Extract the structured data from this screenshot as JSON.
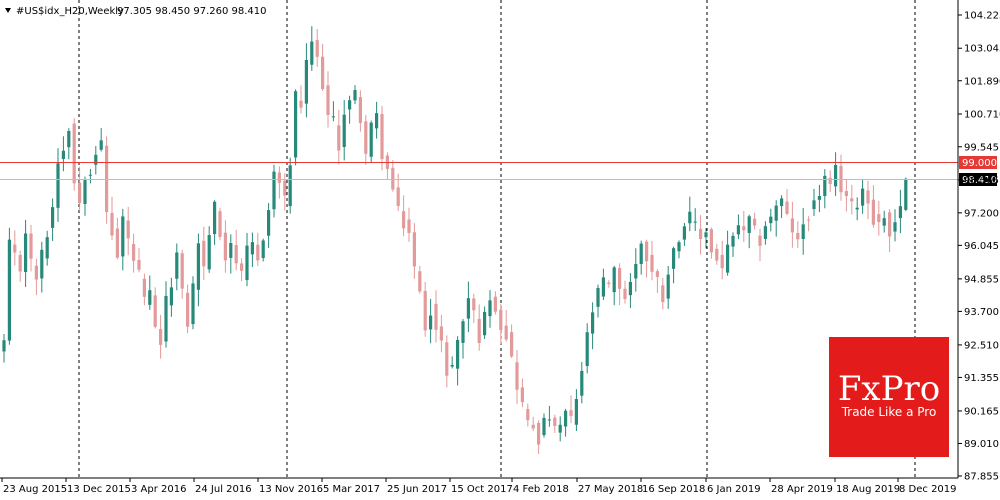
{
  "chart_data": {
    "type": "candlestick",
    "symbol": "#US$idx_H20,Weekly",
    "header_values": "97.305 98.450 97.260 98.410",
    "ylim": [
      87.8,
      104.3
    ],
    "y_ticks": [
      "104.225",
      "103.045",
      "101.890",
      "100.710",
      "99.545",
      "98.365",
      "97.200",
      "96.045",
      "94.855",
      "93.700",
      "92.510",
      "91.355",
      "90.165",
      "89.010",
      "87.855"
    ],
    "x_ticks": [
      "23 Aug 2015",
      "13 Dec 2015",
      "3 Apr 2016",
      "24 Jul 2016",
      "13 Nov 2016",
      "5 Mar 2017",
      "25 Jun 2017",
      "15 Oct 2017",
      "4 Feb 2018",
      "27 May 2018",
      "16 Sep 2018",
      "6 Jan 2019",
      "28 Apr 2019",
      "18 Aug 2019",
      "8 Dec 2019"
    ],
    "vertical_gridlines_at": [
      "13 Dec 2015",
      "13 Nov 2016",
      "4 Feb 2018",
      "6 Jan 2019",
      "8 Dec 2019"
    ],
    "horizontal_lines": [
      {
        "label": "99.000",
        "value": 99.0,
        "color": "#e53935"
      },
      {
        "label": "98.410",
        "value": 98.41,
        "color": "#bdbdbd"
      }
    ],
    "close_path": [
      [
        0,
        92.6
      ],
      [
        1,
        96.0
      ],
      [
        3,
        95.2
      ],
      [
        4,
        96.6
      ],
      [
        5,
        95.4
      ],
      [
        6,
        94.9
      ],
      [
        8,
        96.5
      ],
      [
        9,
        97.4
      ],
      [
        10,
        99.1
      ],
      [
        11,
        99.5
      ],
      [
        12,
        100.3
      ],
      [
        13,
        98.3
      ],
      [
        14,
        97.6
      ],
      [
        15,
        98.6
      ],
      [
        16,
        98.8
      ],
      [
        17,
        99.4
      ],
      [
        18,
        99.6
      ],
      [
        19,
        97.2
      ],
      [
        20,
        96.5
      ],
      [
        21,
        95.6
      ],
      [
        22,
        97.0
      ],
      [
        23,
        96.2
      ],
      [
        24,
        95.5
      ],
      [
        25,
        95.0
      ],
      [
        26,
        94.0
      ],
      [
        27,
        94.3
      ],
      [
        28,
        93.0
      ],
      [
        29,
        92.6
      ],
      [
        30,
        94.0
      ],
      [
        31,
        94.8
      ],
      [
        32,
        95.7
      ],
      [
        33,
        94.3
      ],
      [
        34,
        93.3
      ],
      [
        35,
        94.6
      ],
      [
        36,
        96.2
      ],
      [
        37,
        95.2
      ],
      [
        38,
        96.5
      ],
      [
        39,
        97.4
      ],
      [
        40,
        96.4
      ],
      [
        41,
        95.7
      ],
      [
        42,
        96.2
      ],
      [
        43,
        95.5
      ],
      [
        44,
        94.9
      ],
      [
        45,
        95.8
      ],
      [
        46,
        96.0
      ],
      [
        47,
        95.5
      ],
      [
        48,
        96.4
      ],
      [
        49,
        97.3
      ],
      [
        50,
        98.6
      ],
      [
        51,
        98.3
      ],
      [
        52,
        97.6
      ],
      [
        53,
        99.0
      ],
      [
        54,
        101.3
      ],
      [
        55,
        101.0
      ],
      [
        56,
        102.4
      ],
      [
        57,
        103.3
      ],
      [
        58,
        102.6
      ],
      [
        59,
        101.8
      ],
      [
        60,
        100.6
      ],
      [
        61,
        100.4
      ],
      [
        62,
        99.6
      ],
      [
        63,
        100.8
      ],
      [
        64,
        101.1
      ],
      [
        65,
        101.4
      ],
      [
        66,
        100.6
      ],
      [
        67,
        99.3
      ],
      [
        68,
        100.2
      ],
      [
        69,
        100.6
      ],
      [
        70,
        99.3
      ],
      [
        71,
        98.7
      ],
      [
        72,
        98.0
      ],
      [
        73,
        97.2
      ],
      [
        74,
        96.8
      ],
      [
        75,
        96.5
      ],
      [
        76,
        95.2
      ],
      [
        77,
        94.3
      ],
      [
        78,
        93.2
      ],
      [
        79,
        93.8
      ],
      [
        80,
        93.0
      ],
      [
        81,
        92.5
      ],
      [
        82,
        91.6
      ],
      [
        83,
        91.8
      ],
      [
        84,
        92.6
      ],
      [
        85,
        93.4
      ],
      [
        86,
        94.2
      ],
      [
        87,
        93.6
      ],
      [
        88,
        92.8
      ],
      [
        89,
        93.5
      ],
      [
        90,
        94.3
      ],
      [
        91,
        93.9
      ],
      [
        92,
        93.2
      ],
      [
        93,
        92.9
      ],
      [
        94,
        92.0
      ],
      [
        95,
        91.1
      ],
      [
        96,
        90.4
      ],
      [
        97,
        89.7
      ],
      [
        98,
        89.6
      ],
      [
        99,
        89.2
      ],
      [
        100,
        89.7
      ],
      [
        101,
        90.0
      ],
      [
        102,
        89.4
      ],
      [
        103,
        89.6
      ],
      [
        104,
        90.1
      ],
      [
        105,
        89.8
      ],
      [
        106,
        90.6
      ],
      [
        107,
        91.6
      ],
      [
        108,
        92.8
      ],
      [
        109,
        93.7
      ],
      [
        110,
        94.3
      ],
      [
        111,
        94.8
      ],
      [
        112,
        94.5
      ],
      [
        113,
        95.1
      ],
      [
        114,
        94.6
      ],
      [
        115,
        94.2
      ],
      [
        116,
        94.8
      ],
      [
        117,
        95.3
      ],
      [
        118,
        96.2
      ],
      [
        119,
        95.6
      ],
      [
        120,
        95.1
      ],
      [
        121,
        94.8
      ],
      [
        122,
        94.2
      ],
      [
        123,
        95.2
      ],
      [
        124,
        95.8
      ],
      [
        125,
        96.4
      ],
      [
        126,
        96.8
      ],
      [
        127,
        97.0
      ],
      [
        128,
        96.7
      ],
      [
        129,
        96.3
      ],
      [
        130,
        96.6
      ],
      [
        131,
        95.8
      ],
      [
        132,
        95.6
      ],
      [
        133,
        95.2
      ],
      [
        134,
        95.9
      ],
      [
        135,
        96.3
      ],
      [
        136,
        96.8
      ],
      [
        137,
        96.4
      ],
      [
        138,
        96.9
      ],
      [
        139,
        96.5
      ],
      [
        140,
        96.2
      ],
      [
        141,
        96.8
      ],
      [
        142,
        97.0
      ],
      [
        143,
        97.5
      ],
      [
        144,
        97.6
      ],
      [
        145,
        97.0
      ],
      [
        146,
        96.6
      ],
      [
        147,
        96.1
      ],
      [
        148,
        96.8
      ],
      [
        149,
        97.2
      ],
      [
        150,
        97.5
      ],
      [
        151,
        97.9
      ],
      [
        152,
        98.4
      ],
      [
        153,
        98.0
      ],
      [
        154,
        98.7
      ],
      [
        155,
        98.1
      ],
      [
        156,
        97.8
      ],
      [
        157,
        97.4
      ],
      [
        158,
        97.6
      ],
      [
        159,
        98.1
      ],
      [
        160,
        97.6
      ],
      [
        161,
        97.0
      ],
      [
        162,
        96.8
      ],
      [
        163,
        97.1
      ],
      [
        164,
        96.4
      ],
      [
        165,
        97.0
      ],
      [
        166,
        97.3
      ],
      [
        167,
        98.41
      ]
    ]
  },
  "branding": {
    "logo_text": "FxPro",
    "logo_tagline": "Trade Like a Pro",
    "logo_bg": "#e31b1b"
  },
  "colors": {
    "bull": "#26897a",
    "bear": "#e29a9a",
    "grid_dash": "#000000",
    "red_line": "#e53935",
    "grey_line": "#c8c8c8",
    "axis": "#000000"
  }
}
